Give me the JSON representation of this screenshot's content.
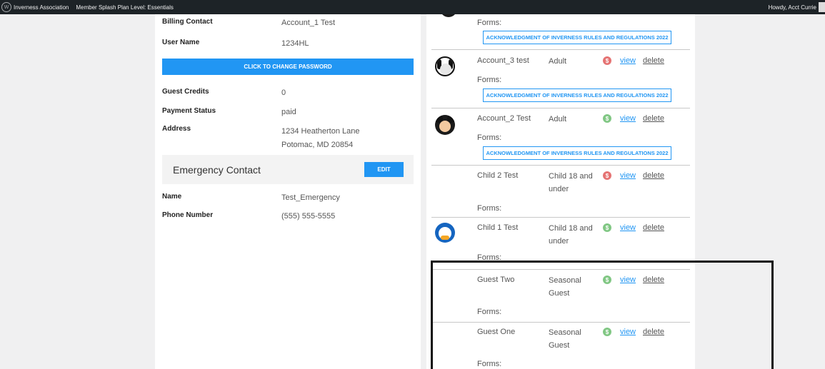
{
  "adminbar": {
    "site_name": "Inverness Association",
    "plan": "Member Splash Plan Level: Essentials",
    "howdy": "Howdy, Acct Currie"
  },
  "account": {
    "billing_contact_label": "Billing Contact",
    "billing_contact": "Account_1 Test",
    "username_label": "User Name",
    "username": "1234HL",
    "change_password_label": "CLICK TO CHANGE PASSWORD",
    "guest_credits_label": "Guest Credits",
    "guest_credits": "0",
    "payment_status_label": "Payment Status",
    "payment_status": "paid",
    "address_label": "Address",
    "address_line1": "1234 Heatherton Lane",
    "address_line2": "Potomac, MD 20854"
  },
  "emergency": {
    "title": "Emergency Contact",
    "edit_label": "EDIT",
    "name_label": "Name",
    "name": "Test_Emergency",
    "phone_label": "Phone Number",
    "phone": "(555) 555-5555"
  },
  "members": {
    "forms_label": "Forms:",
    "form_doc": "ACKNOWLEDGMENT OF INVERNESS RULES AND REGULATIONS 2022",
    "view_label": "view",
    "delete_label": "delete",
    "pay_symbol": "$",
    "list": [
      {
        "name": "Account_3 test",
        "type": "Adult",
        "status": "unpaid",
        "avatar": "goofy-avatar"
      },
      {
        "name": "Account_2 Test",
        "type": "Adult",
        "status": "paid",
        "avatar": "mickey-avatar"
      },
      {
        "name": "Child 2 Test",
        "type_line1": "Child 18 and",
        "type_line2": "under",
        "status": "unpaid"
      },
      {
        "name": "Child 1 Test",
        "type_line1": "Child 18 and",
        "type_line2": "under",
        "status": "paid",
        "avatar": "donald-avatar"
      },
      {
        "name": "Guest Two",
        "type_line1": "Seasonal",
        "type_line2": "Guest",
        "status": "paid"
      },
      {
        "name": "Guest One",
        "type_line1": "Seasonal",
        "type_line2": "Guest",
        "status": "paid"
      }
    ]
  },
  "colors": {
    "accent": "#2196f3",
    "unpaid": "#e57373",
    "paid": "#81c784",
    "adminbar": "#1d2327"
  }
}
